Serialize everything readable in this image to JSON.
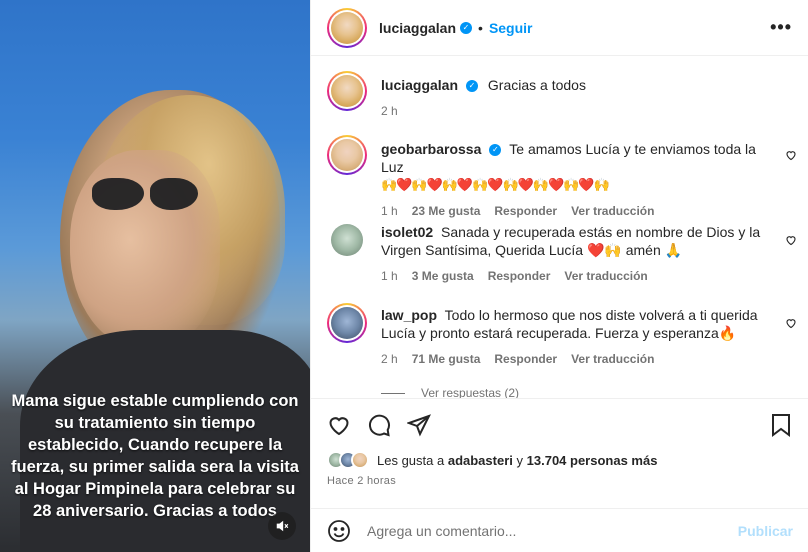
{
  "post": {
    "caption_overlay": "Mama sigue estable cumpliendo con su tratamiento sin tiempo establecido, Cuando recupere la fuerza, su primer salida sera la visita al Hogar Pimpinela para celebrar su 28 aniversario. Gracias a todos"
  },
  "header": {
    "username": "luciaggalan",
    "follow_label": "Seguir",
    "dot": "•",
    "more": "•••"
  },
  "author_comment": {
    "username": "luciaggalan",
    "text": "Gracias a todos",
    "time": "2 h"
  },
  "comments": [
    {
      "username": "geobarbarossa",
      "text": "Te amamos Lucía y te enviamos toda la Luz",
      "emoji_line": "🙌❤️🙌❤️🙌❤️🙌❤️🙌❤️🙌❤️🙌❤️🙌",
      "time": "1 h",
      "likes": "23 Me gusta",
      "reply": "Responder",
      "translate": "Ver traducción"
    },
    {
      "username": "isolet02",
      "text": "Sanada y recuperada estás en nombre de Dios y la Virgen Santísima, Querida Lucía ❤️🙌 amén 🙏",
      "time": "1 h",
      "likes": "3 Me gusta",
      "reply": "Responder",
      "translate": "Ver traducción"
    },
    {
      "username": "law_pop",
      "text": "Todo lo hermoso que nos diste volverá a ti querida Lucía y pronto estará recuperada. Fuerza y esperanza🔥",
      "time": "2 h",
      "likes": "71 Me gusta",
      "reply": "Responder",
      "translate": "Ver traducción"
    }
  ],
  "view_replies": "Ver respuestas (2)",
  "likes": {
    "prefix": "Les gusta a",
    "user": "adabasteri",
    "middle": "y",
    "count": "13.704 personas más"
  },
  "time_ago": "Hace 2 horas",
  "add_comment": {
    "placeholder": "Agrega un comentario...",
    "publish": "Publicar"
  },
  "colors": {
    "link": "#0095f6",
    "muted": "#737373"
  }
}
